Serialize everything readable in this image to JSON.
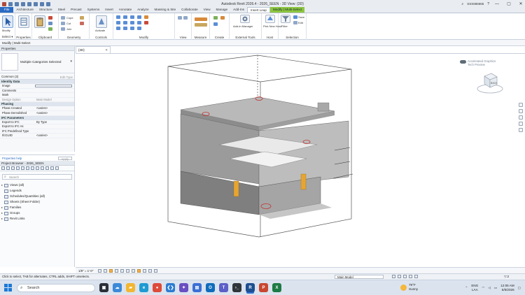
{
  "titlebar": {
    "title": "Autodesk Revit 2026.4 - 2026_SEEN - 3D View: {3D}",
    "user": "SSS686665",
    "minimize": "—",
    "maximize": "▢",
    "close": "✕"
  },
  "ribbon_tabs": [
    {
      "label": "File"
    },
    {
      "label": "Architecture"
    },
    {
      "label": "Structure"
    },
    {
      "label": "Steel"
    },
    {
      "label": "Precast"
    },
    {
      "label": "Systems"
    },
    {
      "label": "Insert"
    },
    {
      "label": "Annotate"
    },
    {
      "label": "Analyze"
    },
    {
      "label": "Massing & Site"
    },
    {
      "label": "Collaborate"
    },
    {
      "label": "View"
    },
    {
      "label": "Manage"
    },
    {
      "label": "Add-Ins"
    },
    {
      "label": "Insert Leap"
    },
    {
      "label": "Modify | Multi-Select"
    }
  ],
  "ribbon": {
    "select_label": "Select ▾",
    "modify_label": "Modify",
    "properties_label": "Properties",
    "clipboard_label": "Clipboard",
    "geometry_label": "Geometry",
    "controls_label": "Controls",
    "modify_panel_label": "Modify",
    "view_label": "View",
    "measure_label": "Measure",
    "create_label": "Create",
    "external_tools_label": "External Tools",
    "host_label": "Host",
    "selection_label": "Selection",
    "cope_label": "Cope",
    "cut_label": "Cut",
    "join_label": "Join",
    "activate_label": "Activate",
    "addin_manager_label": "Add-in Manager",
    "pick_new_host_label": "Pick New Host",
    "filter_label": "Filter",
    "save_label": "Save",
    "edit_label": "Edit"
  },
  "options_bar": {
    "text": "Modify | Multi-Select"
  },
  "properties": {
    "header": "Properties",
    "type_name": "Multiple Categories Selected",
    "selection_count": "Common (2)",
    "edit_type": "Edit Type",
    "groups": [
      {
        "name": "Identity Data",
        "rows": [
          {
            "key": "Image",
            "value": "",
            "box": true
          },
          {
            "key": "Comments",
            "value": ""
          },
          {
            "key": "Mark",
            "value": ""
          },
          {
            "key": "Design Option",
            "value": "Main Model"
          }
        ]
      },
      {
        "name": "Phasing",
        "rows": [
          {
            "key": "Phase Created",
            "value": "<varies>"
          },
          {
            "key": "Phase Demolished",
            "value": "<varies>"
          }
        ]
      },
      {
        "name": "IFC Parameters",
        "rows": [
          {
            "key": "Export to IFC",
            "value": "By Type"
          },
          {
            "key": "Export to IFC As",
            "value": ""
          },
          {
            "key": "IFC Predefined Type",
            "value": ""
          },
          {
            "key": "IfcGUID",
            "value": "<varies>"
          }
        ]
      }
    ],
    "help_link": "Properties help",
    "apply": "Apply"
  },
  "project_browser": {
    "header": "Project Browser - 2026_SEEN",
    "search_placeholder": "Search",
    "items": [
      {
        "label": "Views (all)",
        "expander": "▸"
      },
      {
        "label": "Legends",
        "expander": ""
      },
      {
        "label": "Schedules/Quantities (all)",
        "expander": ""
      },
      {
        "label": "Sheets (Sheet Folder)",
        "expander": ""
      },
      {
        "label": "Families",
        "expander": "▸"
      },
      {
        "label": "Groups",
        "expander": "▸"
      },
      {
        "label": "Revit Links",
        "expander": "▸"
      }
    ]
  },
  "view": {
    "tab_label": "{3D}",
    "close": "✕",
    "accel_line1": "Accelerated Graphics",
    "accel_line2": "Tech Preview",
    "cube_face": "BACK",
    "scale": "1/8\" = 1'-0\""
  },
  "status": {
    "message": "Click to select, TAB for alternates, CTRL adds, SHIFT unselects.",
    "model": "Main Model",
    "filter_count": "▽:2"
  },
  "taskbar": {
    "search_placeholder": "Search",
    "weather_temp": "79°F",
    "weather_desc": "Sunny",
    "lang_line1": "ENG",
    "lang_line2": "LAA",
    "time": "12:05 AM",
    "date": "5/5/2026",
    "apps": [
      {
        "name": "task-view",
        "glyph": "▣",
        "color": "#2a2f3a"
      },
      {
        "name": "weather-app",
        "glyph": "☁",
        "color": "#3c89d8"
      },
      {
        "name": "file-explorer",
        "glyph": "▰",
        "color": "#f2b632"
      },
      {
        "name": "edge",
        "glyph": "e",
        "color": "#1f9bd1"
      },
      {
        "name": "chrome",
        "glyph": "●",
        "color": "#dd4b39"
      },
      {
        "name": "vscode",
        "glyph": "❮❯",
        "color": "#2c7cd2"
      },
      {
        "name": "copilot",
        "glyph": "✦",
        "color": "#6a4fc2"
      },
      {
        "name": "store",
        "glyph": "▤",
        "color": "#3a6fd6"
      },
      {
        "name": "outlook",
        "glyph": "O",
        "color": "#0f6cbd"
      },
      {
        "name": "teams",
        "glyph": "T",
        "color": "#5b5fc7"
      },
      {
        "name": "terminal",
        "glyph": "›_",
        "color": "#30343b"
      },
      {
        "name": "revit",
        "glyph": "R",
        "color": "#1d4f91"
      },
      {
        "name": "powerpoint",
        "glyph": "P",
        "color": "#c8462f"
      },
      {
        "name": "excel",
        "glyph": "X",
        "color": "#1d7a44"
      }
    ]
  }
}
